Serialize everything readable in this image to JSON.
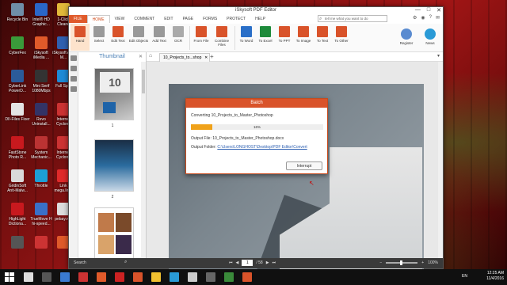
{
  "desktop": {
    "icons": [
      {
        "label": "Recycle Bin",
        "color": "#6f8fa8"
      },
      {
        "label": "Intel® HD Graphic...",
        "color": "#2a67c8"
      },
      {
        "label": "1-Click Cleane",
        "color": "#e2b93a"
      },
      {
        "label": "CyberFex",
        "color": "#3a9a3a"
      },
      {
        "label": "iSkysoft iMedia ...",
        "color": "#e05a2a"
      },
      {
        "label": "iSkysoft App M...",
        "color": "#3060b0"
      },
      {
        "label": "CyberLink PowerD...",
        "color": "#2b5b9a"
      },
      {
        "label": "Mini Serif 1080Mbps",
        "color": "#333"
      },
      {
        "label": "Full Sp...",
        "color": "#1d8ad6"
      },
      {
        "label": "DII-Files Fixer",
        "color": "#e4e4e4"
      },
      {
        "label": "Revo Uninstall...",
        "color": "#336"
      },
      {
        "label": "Internet Cyclone",
        "color": "#c33"
      },
      {
        "label": "FastStone Photo R...",
        "color": "#c8191e"
      },
      {
        "label": "System Mechanic...",
        "color": "#b33"
      },
      {
        "label": "Internet Cyclone",
        "color": "#c33"
      },
      {
        "label": "GridinSoft Anti-Malw...",
        "color": "#d9d9d9"
      },
      {
        "label": "Throttle",
        "color": "#1d9fd6"
      },
      {
        "label": "Link mega.lin...",
        "color": "#e02a2a"
      },
      {
        "label": "HighLight Dictiona...",
        "color": "#c8191e"
      },
      {
        "label": "TrueMove H hi-speed...",
        "color": "#3a70c8"
      },
      {
        "label": "pebay.net",
        "color": "#ddd"
      },
      {
        "label": "",
        "color": "#555"
      },
      {
        "label": "",
        "color": "#c33"
      },
      {
        "label": "",
        "color": "#e05a2a"
      }
    ]
  },
  "window": {
    "title": "iSkysoft PDF Editor",
    "controls": [
      "—",
      "□",
      "✕"
    ],
    "menu": [
      "FILE",
      "HOME",
      "VIEW",
      "COMMENT",
      "EDIT",
      "PAGE",
      "FORMS",
      "PROTECT",
      "HELP"
    ],
    "search_placeholder": "tell me what you want to do",
    "right_tools": [
      "⚙",
      "◉",
      "?",
      "✉"
    ]
  },
  "ribbon": {
    "buttons": [
      {
        "label": "Hand",
        "color": "#d9532a"
      },
      {
        "label": "Select",
        "color": "#999"
      },
      {
        "label": "Edit Text",
        "color": "#d9532a"
      },
      {
        "label": "Edit Objects",
        "color": "#999"
      },
      {
        "label": "Add Text",
        "color": "#999"
      },
      {
        "label": "OCR",
        "color": "#aaa"
      },
      {
        "label": "From File",
        "color": "#d9532a"
      },
      {
        "label": "Combine Files",
        "color": "#d9532a"
      },
      {
        "label": "To Word",
        "color": "#2a6fc8"
      },
      {
        "label": "To Excel",
        "color": "#1d8a3a"
      },
      {
        "label": "To PPT",
        "color": "#d9532a"
      },
      {
        "label": "To Image",
        "color": "#d9532a"
      },
      {
        "label": "To Text",
        "color": "#d9532a"
      },
      {
        "label": "To Other",
        "color": "#d9532a"
      }
    ],
    "register": "Register",
    "news": "News"
  },
  "thumbnails": {
    "title": "Thumbnail",
    "pages": [
      "1",
      "2",
      "3"
    ]
  },
  "document": {
    "tab_title": "10_Projects_to...shop"
  },
  "status": {
    "search": "Search",
    "page_current": "1",
    "page_total": "/ 58",
    "zoom": "100%"
  },
  "dialog": {
    "title": "Batch",
    "converting": "Converting 10_Projects_to_Master_Photoshop",
    "progress_text": "16%",
    "progress": 0.16,
    "output_file_label": "Output File: 10_Projects_to_Master_Photoshop.docx",
    "output_folder_label": "Output Folder: ",
    "output_folder_path": "C:\\Users\\LONGHOST\\Desktop\\PDF Editor\\Convert",
    "interrupt": "Interrupt"
  },
  "taskbar": {
    "lang": "EN",
    "time": "12:25 AM",
    "date": "11/4/2016"
  }
}
